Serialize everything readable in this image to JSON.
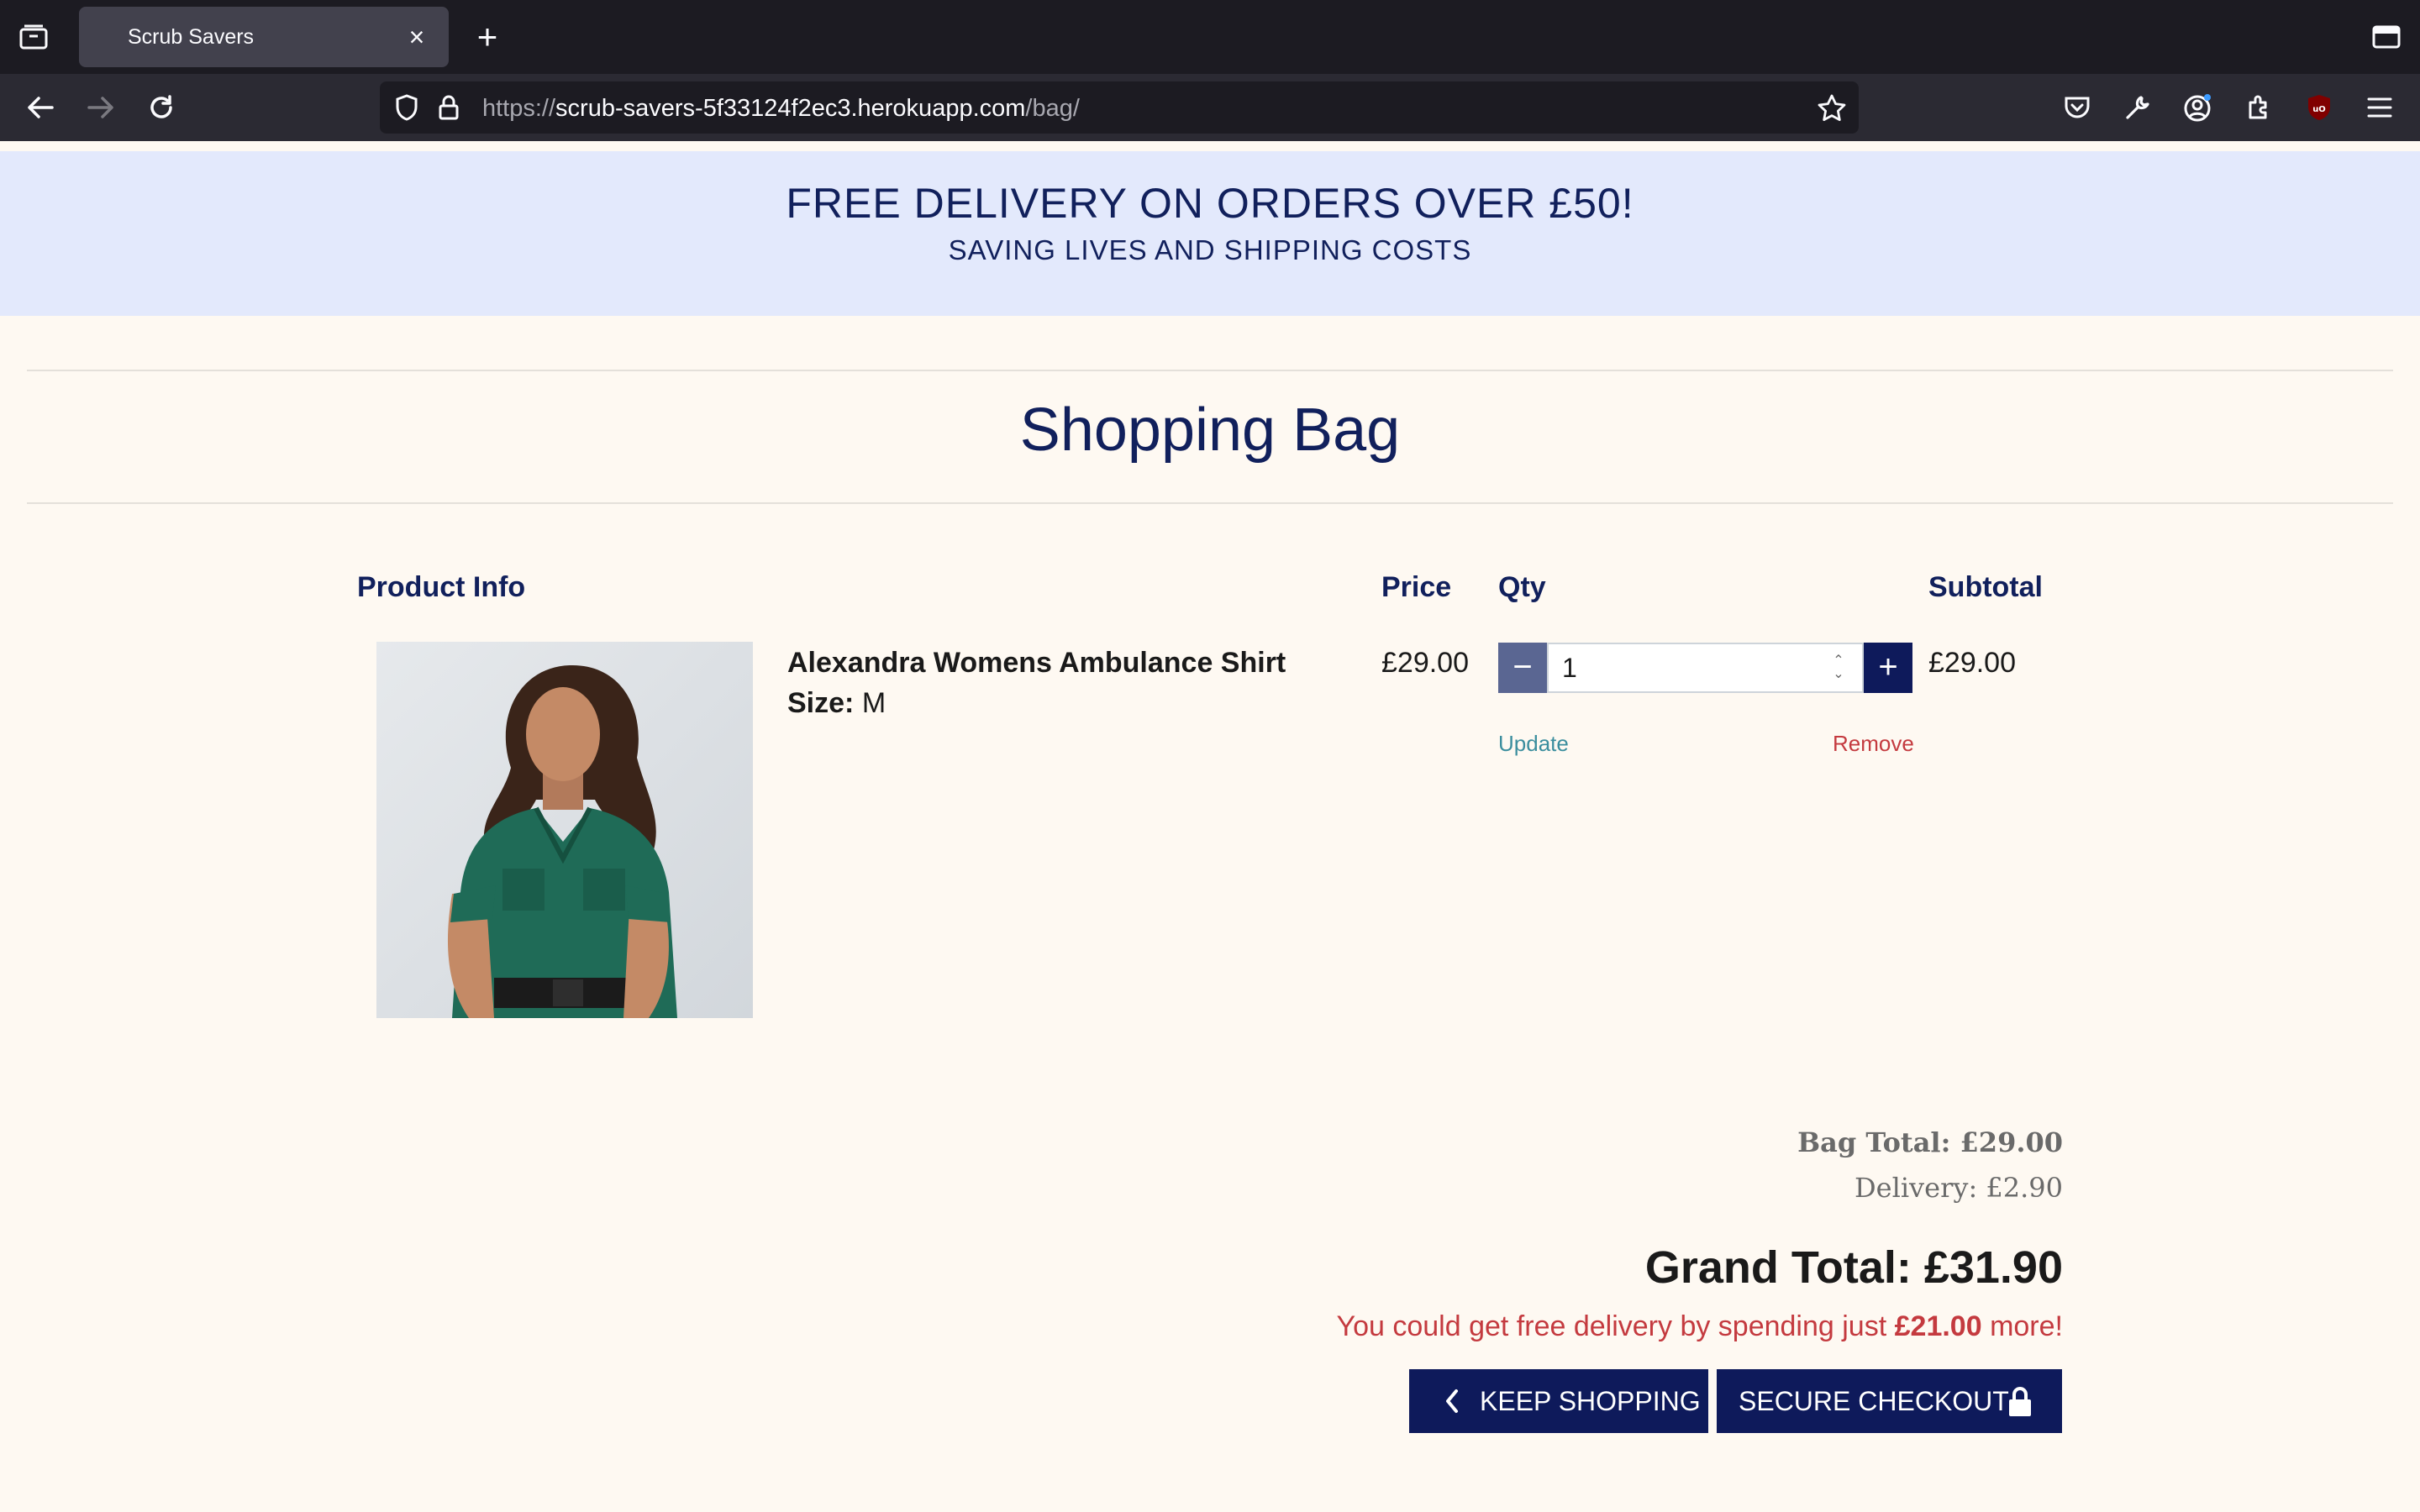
{
  "browser": {
    "tab_title": "Scrub Savers",
    "url_prefix": "https://",
    "url_domain": "scrub-savers-5f33124f2ec3.herokuapp.com",
    "url_path": "/bag/"
  },
  "banner": {
    "headline": "FREE DELIVERY ON ORDERS OVER £50!",
    "subline": "SAVING LIVES AND SHIPPING COSTS"
  },
  "page": {
    "title": "Shopping Bag"
  },
  "table": {
    "headers": {
      "product": "Product Info",
      "price": "Price",
      "qty": "Qty",
      "subtotal": "Subtotal"
    },
    "rows": [
      {
        "name": "Alexandra Womens Ambulance Shirt",
        "size_label": "Size:",
        "size_value": "M",
        "price": "£29.00",
        "qty": "1",
        "subtotal": "£29.00",
        "update_label": "Update",
        "remove_label": "Remove"
      }
    ]
  },
  "summary": {
    "bag_total": "Bag Total: £29.00",
    "delivery": "Delivery: £2.90",
    "grand_total": "Grand Total: £31.90",
    "free_delivery_prefix": "You could get free delivery by spending just",
    "free_delivery_amount": "£21.00",
    "free_delivery_suffix": "more!"
  },
  "buttons": {
    "keep_shopping": "KEEP SHOPPING",
    "secure_checkout": "SECURE CHECKOUT"
  },
  "colors": {
    "navy": "#11205c",
    "banner_bg": "#e3e9fc",
    "page_bg": "#fef9f2",
    "danger": "#c43a3f",
    "link": "#3b8e9e"
  }
}
